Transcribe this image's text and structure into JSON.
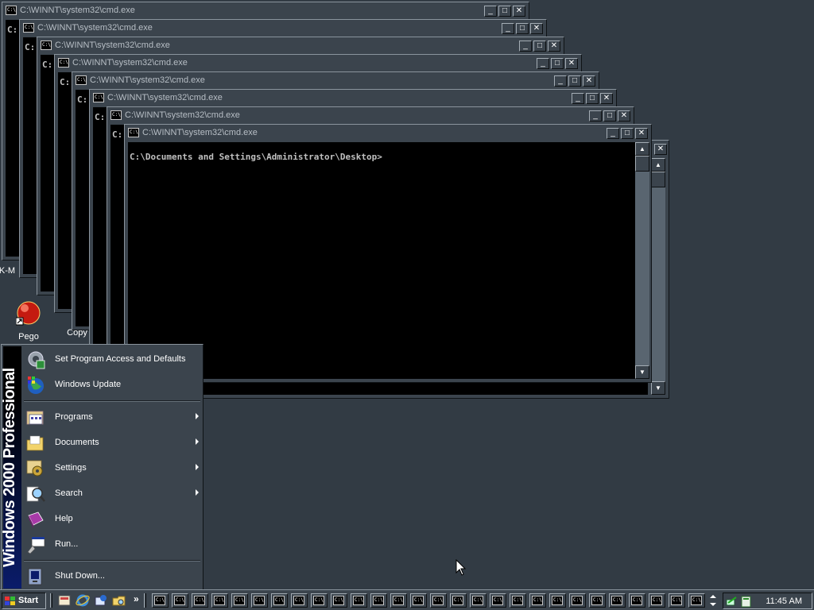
{
  "window_title": "C:\\WINNT\\system32\\cmd.exe",
  "window_buttons": {
    "minimize": "_",
    "maximize": "□",
    "close": "✕"
  },
  "cmd_icon": "C:\\",
  "prompt_text": "C:\\Documents and Settings\\Administrator\\Desktop>",
  "background_prompt": "C:",
  "desktop_icons": [
    {
      "label": "K-M",
      "icon": "generic-icon"
    },
    {
      "label": "Pego",
      "icon": "red-ball-icon"
    },
    {
      "label": "Copy",
      "icon": "copy-icon"
    }
  ],
  "start_menu": {
    "banner": "Windows 2000 Professional",
    "items": [
      {
        "label": "Set Program Access and Defaults",
        "icon": "program-access-icon",
        "submenu": false
      },
      {
        "label": "Windows Update",
        "icon": "globe-update-icon",
        "submenu": false
      },
      {
        "label": "Programs",
        "icon": "programs-icon",
        "submenu": true
      },
      {
        "label": "Documents",
        "icon": "folder-icon",
        "submenu": true
      },
      {
        "label": "Settings",
        "icon": "settings-icon",
        "submenu": true
      },
      {
        "label": "Search",
        "icon": "search-icon",
        "submenu": true
      },
      {
        "label": "Help",
        "icon": "help-book-icon",
        "submenu": false
      },
      {
        "label": "Run...",
        "icon": "run-icon",
        "submenu": false
      },
      {
        "label": "Shut Down...",
        "icon": "shutdown-icon",
        "submenu": false
      }
    ]
  },
  "taskbar": {
    "start_label": "Start",
    "quicklaunch_more": "»",
    "clock": "11:45 AM"
  },
  "colors": {
    "desktop": "#323b44",
    "window_face": "#3b444d",
    "console_bg": "#000000",
    "banner_blue": "#0a1c6a"
  }
}
